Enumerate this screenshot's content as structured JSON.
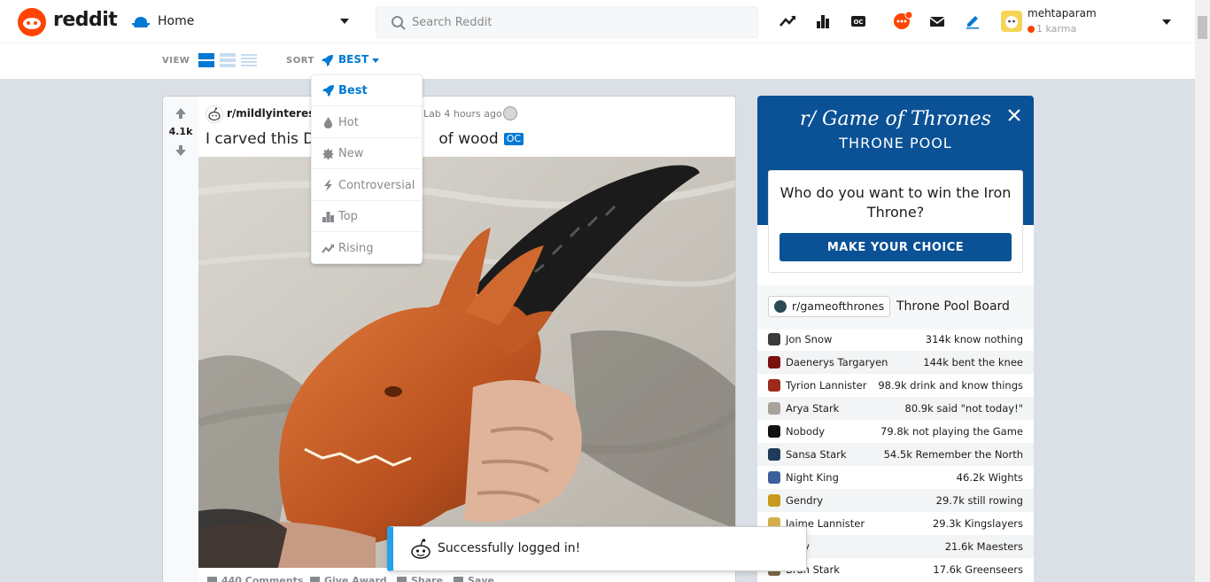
{
  "header": {
    "brand": "reddit",
    "feed_selector": "Home",
    "search_placeholder": "Search Reddit",
    "user": {
      "name": "mehtaparam",
      "karma": "1 karma"
    },
    "icons": [
      "popular-icon",
      "all-icon",
      "community-icon",
      "chat-icon",
      "mail-icon",
      "create-post-icon"
    ]
  },
  "sortbar": {
    "view_label": "VIEW",
    "sort_label": "SORT",
    "current_sort": "BEST"
  },
  "sort_menu": {
    "items": [
      {
        "label": "Best",
        "icon": "rocket-icon",
        "active": true
      },
      {
        "label": "Hot",
        "icon": "flame-icon",
        "active": false
      },
      {
        "label": "New",
        "icon": "new-icon",
        "active": false
      },
      {
        "label": "Controversial",
        "icon": "lightning-icon",
        "active": false
      },
      {
        "label": "Top",
        "icon": "top-icon",
        "active": false
      },
      {
        "label": "Rising",
        "icon": "rising-icon",
        "active": false
      }
    ]
  },
  "post": {
    "score": "4.1k",
    "subreddit": "r/mildlyinteresti",
    "posted_by": "Lab 4 hours ago",
    "title_start": "I carved this D",
    "title_end": "of wood",
    "flair": "OC",
    "actions": {
      "comments": "440 Comments",
      "award": "Give Award",
      "share": "Share",
      "save": "Save",
      "more": "..."
    }
  },
  "got_widget": {
    "title": "r/ Game of Thrones",
    "subtitle": "THRONE POOL",
    "question": "Who do you want to win the Iron Throne?",
    "cta": "MAKE YOUR CHOICE",
    "subreddit": "r/gameofthrones",
    "board_title": "Throne Pool Board",
    "rows": [
      {
        "name": "Jon Snow",
        "stat": "314k know nothing",
        "color": "#3b3b3b"
      },
      {
        "name": "Daenerys Targaryen",
        "stat": "144k bent the knee",
        "color": "#7a1010"
      },
      {
        "name": "Tyrion Lannister",
        "stat": "98.9k drink and know things",
        "color": "#9b2a1a"
      },
      {
        "name": "Arya Stark",
        "stat": "80.9k said \"not today!\"",
        "color": "#a8a39a"
      },
      {
        "name": "Nobody",
        "stat": "79.8k not playing the Game",
        "color": "#111111"
      },
      {
        "name": "Sansa Stark",
        "stat": "54.5k Remember the North",
        "color": "#1f3b5a"
      },
      {
        "name": "Night King",
        "stat": "46.2k Wights",
        "color": "#3c5f9c"
      },
      {
        "name": "Gendry",
        "stat": "29.7k still rowing",
        "color": "#c79a1e"
      },
      {
        "name": "Jaime Lannister",
        "stat": "29.3k Kingslayers",
        "color": "#d1b04a"
      },
      {
        "name": "Tarly",
        "stat": "21.6k Maesters",
        "color": "#6e6e6e"
      },
      {
        "name": "Bran Stark",
        "stat": "17.6k Greenseers",
        "color": "#7d6a4a"
      }
    ]
  },
  "toast": {
    "message": "Successfully logged in!"
  },
  "colors": {
    "brand": "#ff4500",
    "accent": "#0079d3",
    "got_blue": "#0a5196",
    "toast_accent": "#24a0ed"
  }
}
